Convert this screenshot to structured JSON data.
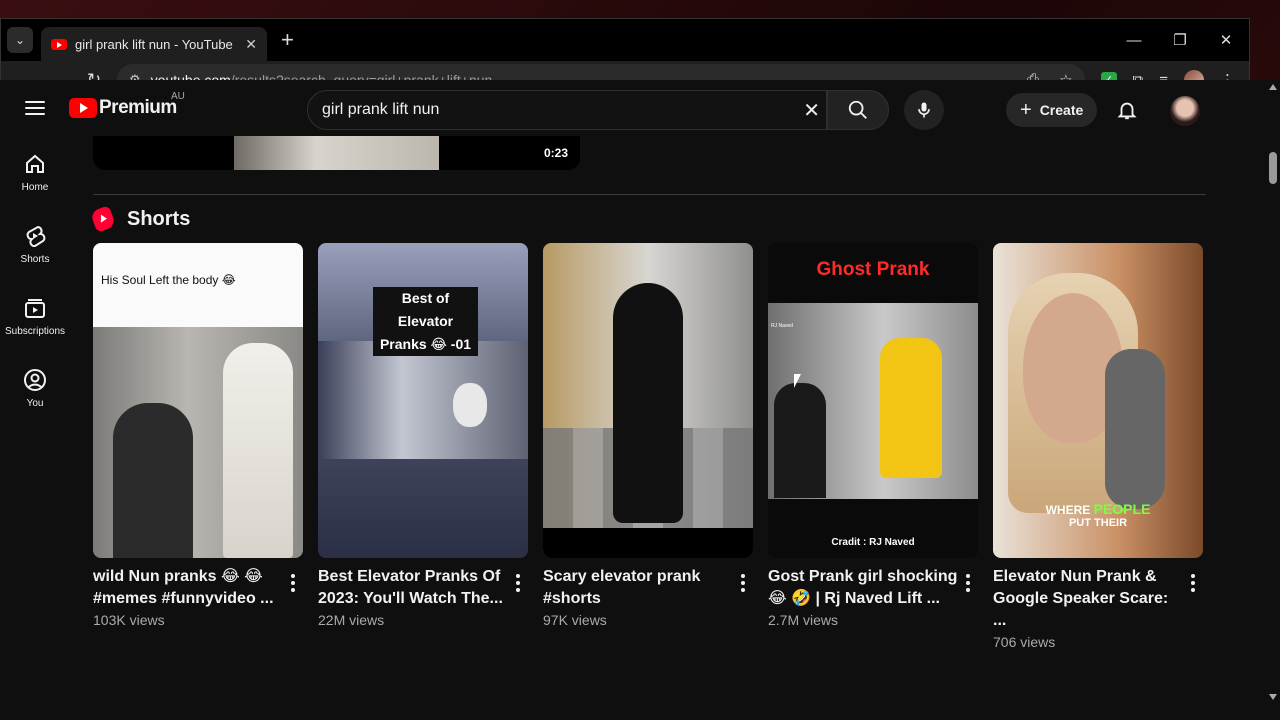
{
  "browser": {
    "tab_title": "girl prank lift nun - YouTube",
    "url_host": "youtube.com",
    "url_rest": "/results?search_query=girl+prank+lift+nun",
    "window_controls": [
      "minimize-icon",
      "restore-icon",
      "close-icon"
    ]
  },
  "masthead": {
    "logo_text": "Premium",
    "region": "AU",
    "search_value": "girl prank lift nun",
    "create_label": "Create"
  },
  "guide": {
    "items": [
      {
        "label": "Home",
        "icon": "home-icon"
      },
      {
        "label": "Shorts",
        "icon": "shorts-icon"
      },
      {
        "label": "Subscriptions",
        "icon": "subscriptions-icon"
      },
      {
        "label": "You",
        "icon": "you-icon"
      }
    ]
  },
  "previous_result": {
    "duration": "0:23"
  },
  "shorts": {
    "section_title": "Shorts",
    "items": [
      {
        "title": "wild Nun pranks 😂 😂 #memes #funnyvideo ...",
        "views": "103K views",
        "thumb_caption": "His Soul Left the body 😂"
      },
      {
        "title": "Best Elevator Pranks Of 2023: You'll Watch The...",
        "views": "22M views",
        "thumb_caption": "Best of Elevator Pranks 😂 -01"
      },
      {
        "title": "Scary elevator prank #shorts",
        "views": "97K views"
      },
      {
        "title": "Gost Prank girl shocking 😂 🤣 | Rj Naved Lift ...",
        "views": "2.7M views",
        "thumb_caption": "Ghost Prank",
        "thumb_credit": "Cradit : RJ Naved",
        "thumb_watermark": "RJ Naved"
      },
      {
        "title": "Elevator Nun Prank & Google Speaker Scare: ...",
        "views": "706 views",
        "thumb_caption_a": "WHERE",
        "thumb_caption_b": "PEOPLE",
        "thumb_caption_c": "PUT THEIR"
      }
    ]
  }
}
